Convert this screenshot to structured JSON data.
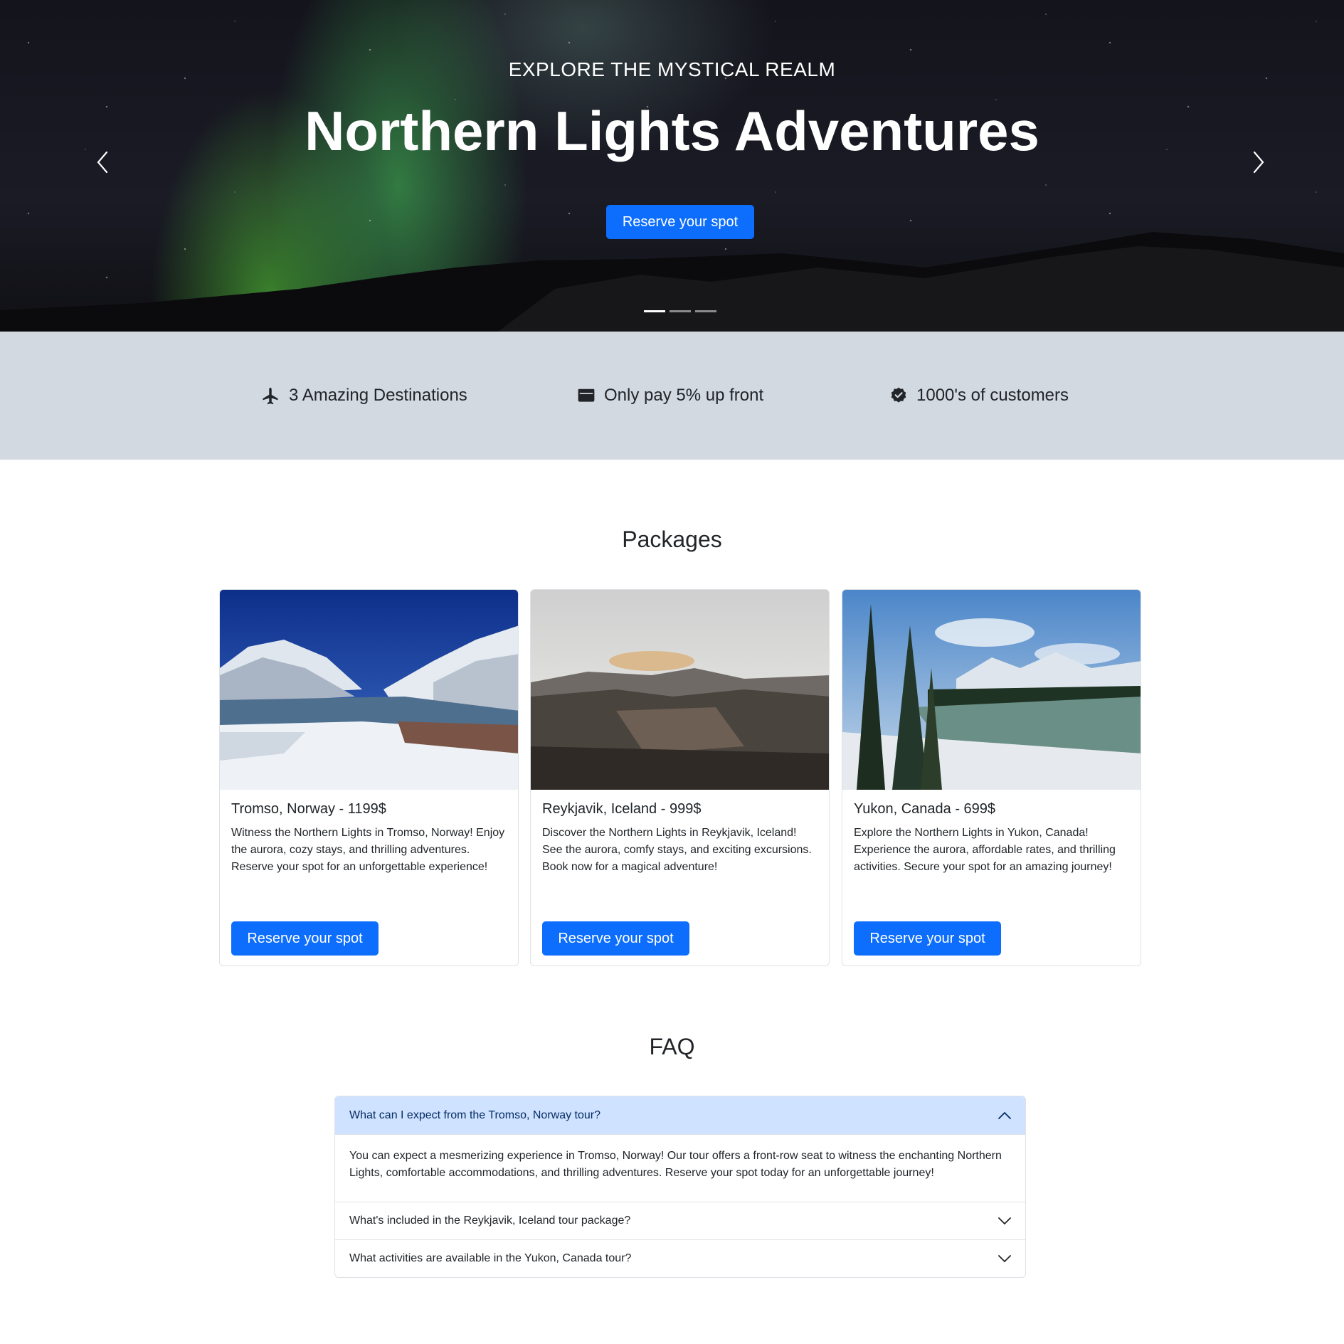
{
  "hero": {
    "eyebrow": "EXPLORE THE MYSTICAL REALM",
    "title": "Northern Lights Adventures",
    "cta_label": "Reserve your spot",
    "slides_total": 3,
    "active_slide": 1
  },
  "features": [
    {
      "icon": "airplane-icon",
      "label": "3 Amazing Destinations"
    },
    {
      "icon": "wallet-icon",
      "label": "Only pay 5% up front"
    },
    {
      "icon": "verified-badge-icon",
      "label": "1000's of customers"
    }
  ],
  "packages": {
    "title": "Packages",
    "cards": [
      {
        "title": "Tromso, Norway - 1199$",
        "text": "Witness the Northern Lights in Tromso, Norway! Enjoy the aurora, cozy stays, and thrilling adventures. Reserve your spot for an unforgettable experience!",
        "button": "Reserve your spot"
      },
      {
        "title": "Reykjavik, Iceland - 999$",
        "text": "Discover the Northern Lights in Reykjavik, Iceland! See the aurora, comfy stays, and exciting excursions. Book now for a magical adventure!",
        "button": "Reserve your spot"
      },
      {
        "title": "Yukon, Canada - 699$",
        "text": "Explore the Northern Lights in Yukon, Canada! Experience the aurora, affordable rates, and thrilling activities. Secure your spot for an amazing journey!",
        "button": "Reserve your spot"
      }
    ]
  },
  "faq": {
    "title": "FAQ",
    "items": [
      {
        "question": "What can I expect from the Tromso, Norway tour?",
        "answer": "You can expect a mesmerizing experience in Tromso, Norway! Our tour offers a front-row seat to witness the enchanting Northern Lights, comfortable accommodations, and thrilling adventures. Reserve your spot today for an unforgettable journey!",
        "expanded": true
      },
      {
        "question": "What's included in the Reykjavik, Iceland tour package?",
        "expanded": false
      },
      {
        "question": "What activities are available in the Yukon, Canada tour?",
        "expanded": false
      }
    ]
  },
  "colors": {
    "primary": "#0d6efd",
    "feature_band": "#d3d9e0",
    "accordion_open": "#cfe2ff"
  }
}
